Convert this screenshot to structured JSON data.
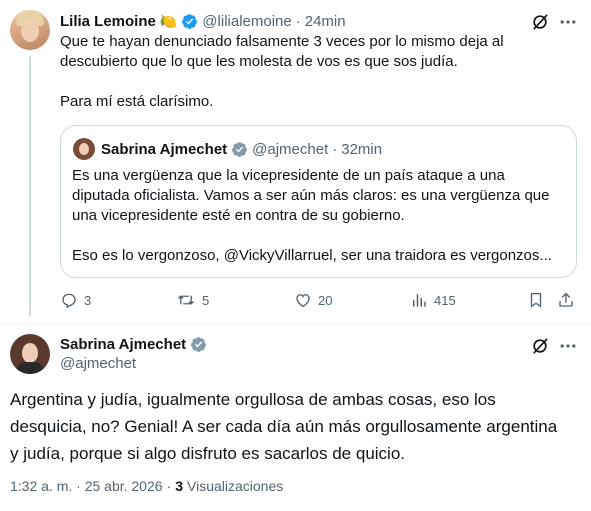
{
  "colors": {
    "verified": "#1d9bf0",
    "text": "#0f1419",
    "muted": "#536471",
    "border": "#cfd9de"
  },
  "tweet1": {
    "author_name": "Lilia Lemoine",
    "emoji": "🍋",
    "handle": "@lilialemoine",
    "separator": "·",
    "time": "24min",
    "text_line1": "Que te hayan denunciado falsamente 3 veces por lo mismo deja al",
    "text_line2": "descubierto que lo que les molesta de vos es que sos judía.",
    "text_line3": "Para mí está clarísimo.",
    "icons": [
      "grok-icon",
      "more-icon"
    ],
    "quote": {
      "author_name": "Sabrina Ajmechet",
      "handle": "@ajmechet",
      "separator": "·",
      "time": "32min",
      "line1": "Es una vergüenza que la vicepresidente de un país ataque a una",
      "line2": "diputada oficialista. Vamos a ser aún más claros: es una vergüenza que",
      "line3": "una vicepresidente esté en contra de su gobierno.",
      "line4": "Eso es lo vergonzoso, @VickyVillarruel, ser una traidora es vergonzos..."
    },
    "actions": {
      "replies": "3",
      "reposts": "5",
      "likes": "20",
      "views": "415"
    }
  },
  "tweet2": {
    "author_name": "Sabrina Ajmechet",
    "handle": "@ajmechet",
    "text_line1": "Argentina y judía, igualmente orgullosa de ambas cosas, eso los",
    "text_line2": "desquicia, no? Genial! A ser cada día aún más orgullosamente argentina",
    "text_line3": "y judía, porque si algo disfruto es sacarlos de quicio.",
    "timestamp": "1:32 a. m. · 25 abr. 2026",
    "separator": "·",
    "views_count": "3",
    "views_label": "Visualizaciones"
  }
}
